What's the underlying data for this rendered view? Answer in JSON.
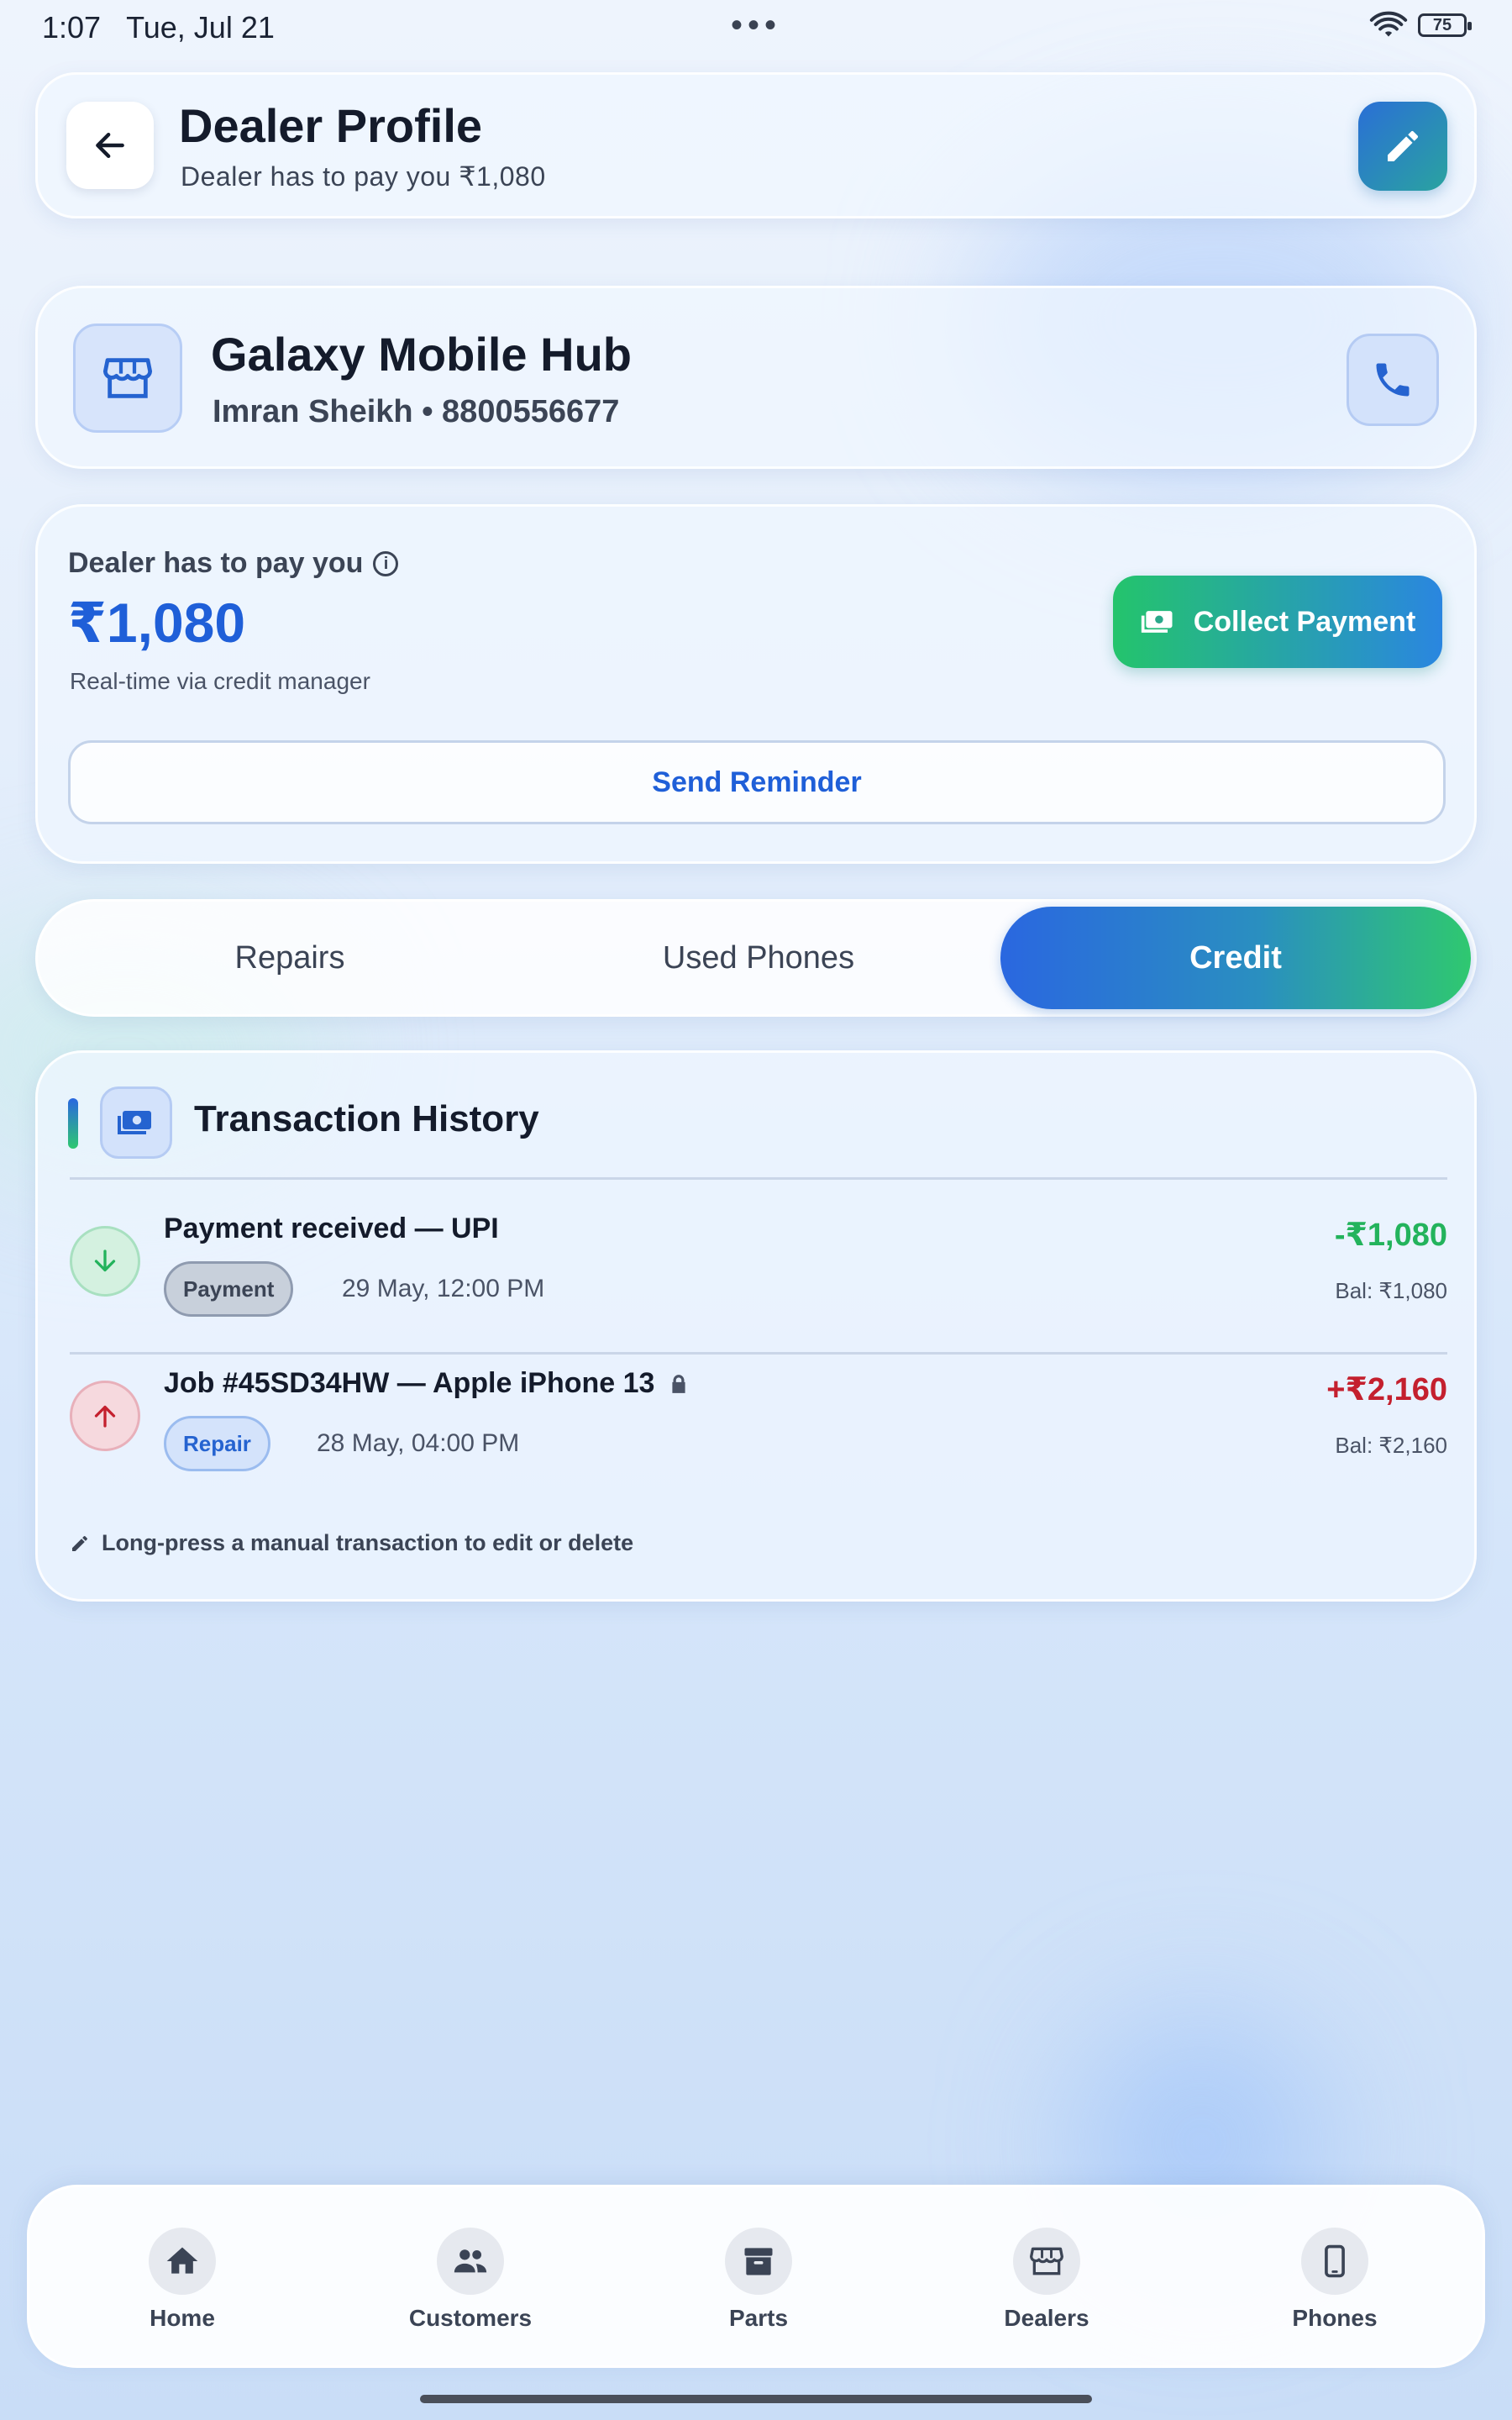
{
  "status_bar": {
    "time": "1:07",
    "date": "Tue, Jul 21",
    "battery": "75"
  },
  "header": {
    "title": "Dealer Profile",
    "subtitle": "Dealer has to pay you ₹1,080"
  },
  "dealer": {
    "name": "Galaxy Mobile Hub",
    "meta": "Imran Sheikh • 8800556677"
  },
  "balance": {
    "label": "Dealer has to pay you",
    "amount": "₹1,080",
    "note": "Real-time via credit manager",
    "collect_label": "Collect Payment",
    "remind_label": "Send Reminder"
  },
  "tabs": [
    {
      "label": "Repairs",
      "active": false
    },
    {
      "label": "Used Phones",
      "active": false
    },
    {
      "label": "Credit",
      "active": true
    }
  ],
  "transactions": {
    "title": "Transaction History",
    "items": [
      {
        "name": "Payment received — UPI",
        "tag": "Payment",
        "time": "29 May, 12:00 PM",
        "amount": "-₹1,080",
        "balance": "Bal: ₹1,080",
        "direction": "in"
      },
      {
        "name": "Job #45SD34HW — Apple iPhone 13",
        "tag": "Repair",
        "time": "28 May, 04:00 PM",
        "amount": "+₹2,160",
        "balance": "Bal: ₹2,160",
        "direction": "out",
        "locked": true
      }
    ],
    "hint": "Long-press a manual transaction to edit or delete"
  },
  "nav": [
    {
      "label": "Home",
      "icon": "home-icon"
    },
    {
      "label": "Customers",
      "icon": "people-icon"
    },
    {
      "label": "Parts",
      "icon": "archive-icon"
    },
    {
      "label": "Dealers",
      "icon": "store-icon"
    },
    {
      "label": "Phones",
      "icon": "phone-device-icon"
    }
  ],
  "colors": {
    "accent_blue": "#1f5fd8",
    "accent_green": "#2fc870",
    "negative_red": "#c4202e",
    "positive_green": "#23b35c"
  }
}
